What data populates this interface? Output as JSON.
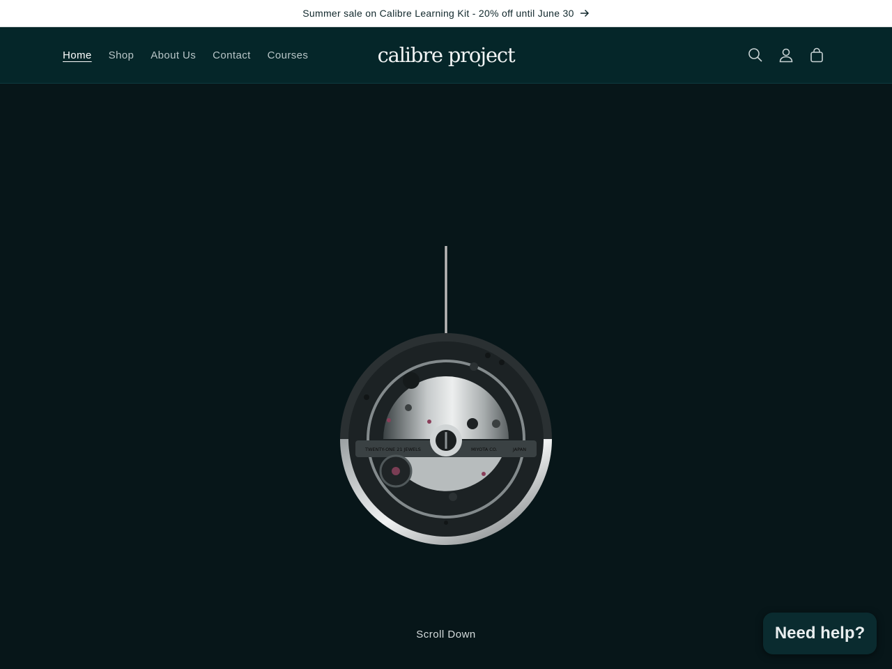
{
  "announcement": {
    "text": "Summer sale on Calibre Learning Kit - 20% off until June 30",
    "icon": "arrow-right-icon"
  },
  "header": {
    "nav": [
      {
        "label": "Home",
        "active": true
      },
      {
        "label": "Shop"
      },
      {
        "label": "About Us"
      },
      {
        "label": "Contact"
      },
      {
        "label": "Courses"
      }
    ],
    "logo": "calibre project",
    "icons": [
      "search-icon",
      "account-icon",
      "cart-icon"
    ]
  },
  "hero": {
    "image": "watch-movement",
    "engravings": [
      "TWENTY-ONE 21 JEWELS",
      "MIYOTA CO.",
      "JAPAN"
    ],
    "scroll_label": "Scroll Down"
  },
  "chat": {
    "label": "Need help?"
  },
  "colors": {
    "header_bg": "#052629",
    "page_bg": "#071619",
    "announcement_bg": "#ffffff"
  }
}
